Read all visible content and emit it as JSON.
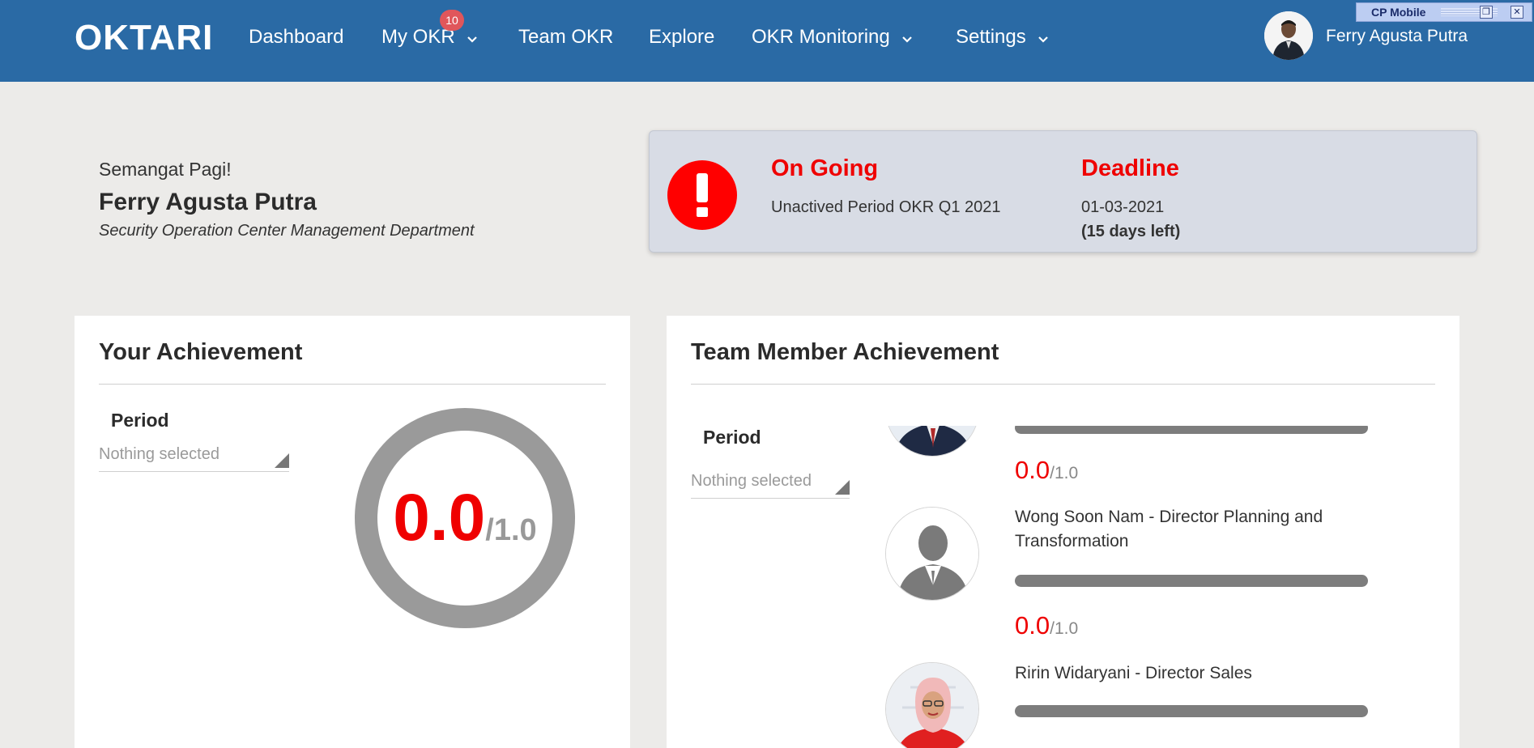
{
  "app": {
    "brand": "OKTARI"
  },
  "nav": {
    "items": [
      {
        "label": "Dashboard"
      },
      {
        "label": "My OKR"
      },
      {
        "label": "Team OKR"
      },
      {
        "label": "Explore"
      },
      {
        "label": "OKR Monitoring"
      },
      {
        "label": "Settings"
      }
    ],
    "my_okr_badge": "10"
  },
  "user": {
    "name": "Ferry Agusta Putra"
  },
  "widget": {
    "title": "CP Mobile"
  },
  "greeting": {
    "hello": "Semangat Pagi!",
    "name": "Ferry Agusta Putra",
    "department": "Security Operation Center Management Department"
  },
  "status": {
    "ongoing_label": "On Going",
    "ongoing_text": "Unactived Period OKR Q1 2021",
    "deadline_label": "Deadline",
    "deadline_date": "01-03-2021",
    "days_left": "(15 days left)"
  },
  "your_achievement": {
    "title": "Your Achievement",
    "period_label": "Period",
    "period_value": "Nothing selected",
    "score": "0.0",
    "max": "/1.0",
    "progress": 0.0
  },
  "team_achievement": {
    "title": "Team Member Achievement",
    "period_label": "Period",
    "period_value": "Nothing selected",
    "members": [
      {
        "name": "",
        "score": "0.0",
        "max": "/1.0",
        "progress": 0.0
      },
      {
        "name": "Wong Soon Nam - Director Planning and Transformation",
        "score": "0.0",
        "max": "/1.0",
        "progress": 0.0
      },
      {
        "name": "Ririn Widaryani - Director Sales",
        "progress": 0.0
      }
    ]
  },
  "colors": {
    "nav_bg": "#2a6aa5",
    "alert": "#ff0000",
    "score": "#ef0000",
    "page_bg": "#ecebe9"
  }
}
